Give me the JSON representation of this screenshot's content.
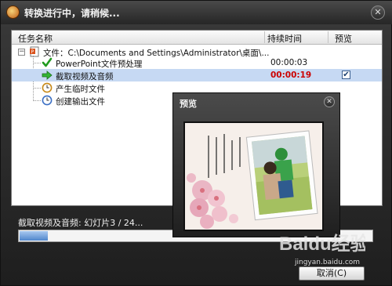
{
  "window": {
    "title": "转换进行中，请稍候...",
    "close_glyph": "✕"
  },
  "list": {
    "columns": {
      "name": "任务名称",
      "duration": "持续时间",
      "preview": "预览"
    },
    "root": {
      "label": "文件：C:\\Documents and Settings\\Administrator\\桌面\\...",
      "expander": "−"
    },
    "items": [
      {
        "label": "PowerPoint文件预处理",
        "duration": "00:00:03",
        "icon": "green-check-icon"
      },
      {
        "label": "截取视频及音频",
        "duration": "00:00:19",
        "icon": "green-arrow-icon",
        "selected": true,
        "preview_checked": true,
        "check_glyph": "✔"
      },
      {
        "label": "产生临时文件",
        "duration": "",
        "icon": "clock-icon"
      },
      {
        "label": "创建输出文件",
        "duration": "",
        "icon": "clock-icon"
      }
    ]
  },
  "status": {
    "text": "截取视频及音频: 幻灯片3 / 24...",
    "progress": 0.08
  },
  "buttons": {
    "cancel": "取消(C)"
  },
  "preview": {
    "title": "预览",
    "close_glyph": "✕"
  },
  "watermark": {
    "brand": "Baidu经验",
    "url": "jingyan.baidu.com"
  },
  "colors": {
    "duration_highlight": "#cc0000",
    "selected_row": "#c6d9f3",
    "progress": "#4f86cc"
  }
}
